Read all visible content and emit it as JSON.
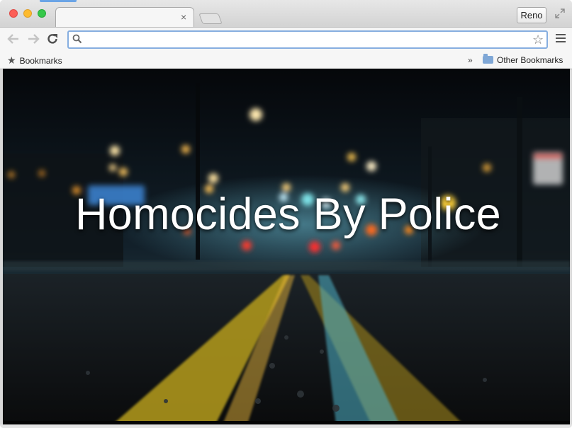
{
  "browser": {
    "profile_label": "Reno",
    "tab_close": "×",
    "omnibox_value": "",
    "bookmarks_label": "Bookmarks",
    "chevron": "»",
    "other_bookmarks_label": "Other Bookmarks"
  },
  "page": {
    "headline": "Homocides By Police"
  },
  "colors": {
    "accent_blue": "#6aa4e6",
    "focus_ring": "#86aee0"
  },
  "icons": [
    "back-arrow-icon",
    "forward-arrow-icon",
    "reload-icon",
    "search-icon",
    "star-icon",
    "menu-icon",
    "folder-icon",
    "fullscreen-icon"
  ]
}
